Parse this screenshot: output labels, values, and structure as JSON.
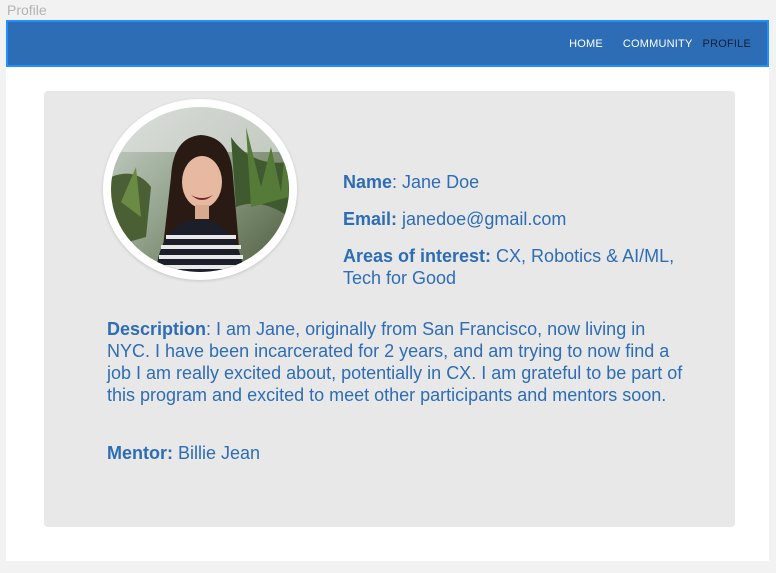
{
  "window": {
    "title": "Profile"
  },
  "nav": {
    "items": [
      {
        "label": "HOME",
        "active": false
      },
      {
        "label": "COMMUNITY",
        "active": false
      },
      {
        "label": "PROFILE",
        "active": true
      }
    ]
  },
  "profile": {
    "name_label": "Name",
    "name_value": ": Jane Doe",
    "email_label": "Email:",
    "email_value": " janedoe@gmail.com",
    "interests_label": "Areas of interest:",
    "interests_value": " CX, Robotics & AI/ML, Tech for Good",
    "description_label": "Description",
    "description_value": ": I am Jane, originally from San Francisco, now living in NYC. I have been incarcerated for 2 years, and am trying to now find a job I am really excited about, potentially in CX. I am grateful to be part of this program and excited to meet other participants and mentors soon.",
    "mentor_label": "Mentor:",
    "mentor_value": " Billie Jean"
  },
  "colors": {
    "accent": "#2d6db5",
    "nav_border": "#1e90ff",
    "card_bg": "#e8e8e8",
    "active_nav": "#10213a"
  }
}
